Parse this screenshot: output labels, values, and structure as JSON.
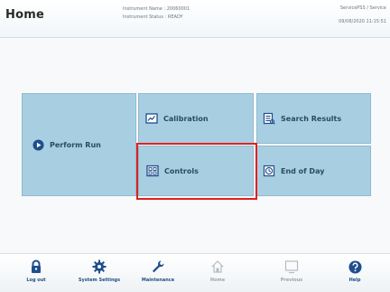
{
  "header": {
    "title": "Home",
    "instrument_name": "Instrument Name : 20060001",
    "instrument_status": "Instrument Status : READY",
    "user": "ServicePSS / Service",
    "datetime": "09/08/2020 11:15:51"
  },
  "tiles": {
    "perform_run": "Perform Run",
    "calibration": "Calibration",
    "search_results": "Search Results",
    "controls": "Controls",
    "end_of_day": "End of Day"
  },
  "footer": {
    "logout": "Log out",
    "system_settings": "System Settings",
    "maintenance": "Maintenance",
    "home": "Home",
    "previous": "Previous",
    "help": "Help"
  },
  "colors": {
    "tile_bg": "#a8cfe1",
    "tile_text": "#2a4b60",
    "footer_text": "#1f4f80",
    "highlight": "#e02020"
  },
  "icons": {
    "perform_run": "play-circle-icon",
    "calibration": "chart-icon",
    "search_results": "list-icon",
    "controls": "controls-grid-icon",
    "end_of_day": "clock-icon",
    "logout": "lock-icon",
    "system_settings": "gear-icon",
    "maintenance": "wrench-icon",
    "home": "home-icon",
    "previous": "previous-screen-icon",
    "help": "help-icon"
  }
}
